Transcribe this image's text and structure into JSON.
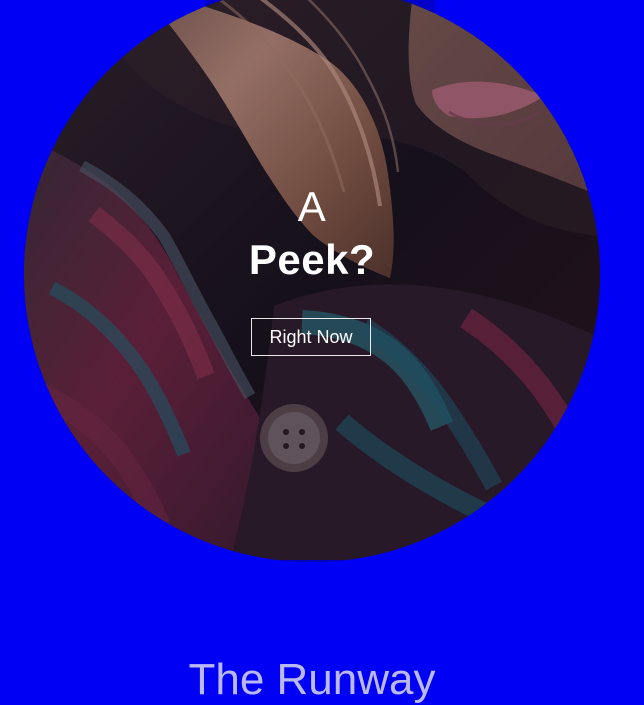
{
  "colors": {
    "background": "#0000f5",
    "hero_text": "#ffffff",
    "section_title": "#b9b8f3"
  },
  "hero": {
    "line_1": "A",
    "line_2": "Peek?",
    "cta_label": "Right Now"
  },
  "section": {
    "title": "The Runway"
  }
}
